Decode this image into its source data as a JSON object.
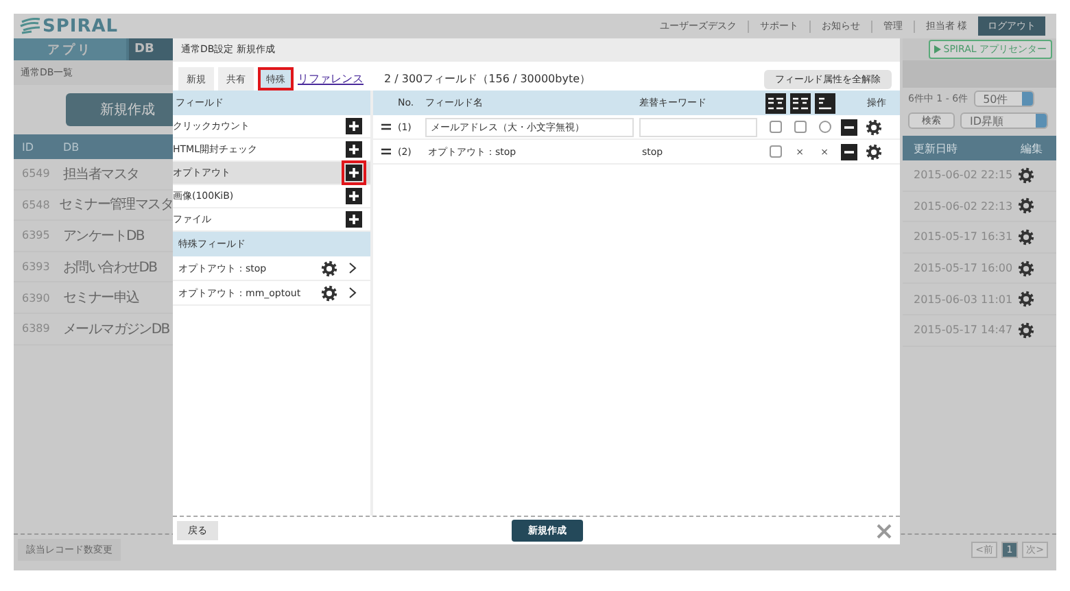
{
  "header": {
    "logo": "SPIRAL",
    "links": [
      "ユーザーズデスク",
      "サポート",
      "お知らせ",
      "管理",
      "担当者 様"
    ],
    "logout": "ログアウト"
  },
  "nav_tabs": [
    {
      "label": "アプリ",
      "selected": false
    },
    {
      "label": "DB",
      "selected": true
    }
  ],
  "app_center": "SPIRAL アプリセンター",
  "db_list": {
    "title": "通常DB一覧",
    "new_button": "新規作成",
    "summary": "6件中 1 - 6件",
    "per_page": "50件",
    "search_button": "検索",
    "sort": "ID昇順",
    "columns": [
      "ID",
      "DB",
      "更新日時",
      "編集"
    ],
    "rows": [
      {
        "id": "6549",
        "db": "担当者マスタ",
        "updated": "2015-06-02 22:15"
      },
      {
        "id": "6548",
        "db": "セミナー管理マスタ",
        "updated": "2015-06-02 22:13"
      },
      {
        "id": "6395",
        "db": "アンケートDB",
        "updated": "2015-05-17 16:31"
      },
      {
        "id": "6393",
        "db": "お問い合わせDB",
        "updated": "2015-05-17 16:00"
      },
      {
        "id": "6390",
        "db": "セミナー申込",
        "updated": "2015-06-03 11:01"
      },
      {
        "id": "6389",
        "db": "メールマガジンDB",
        "updated": "2015-05-17 14:47"
      }
    ]
  },
  "footer": {
    "record_button": "該当レコード数変更",
    "pager": {
      "prev": "<前",
      "page": "1",
      "next": "次>"
    }
  },
  "modal": {
    "title": "通常DB設定 新規作成",
    "tabs": [
      {
        "label": "新規",
        "selected": false,
        "highlighted": false
      },
      {
        "label": "共有",
        "selected": false,
        "highlighted": false
      },
      {
        "label": "特殊",
        "selected": true,
        "highlighted": true
      }
    ],
    "reference_link": "リファレンス",
    "field_count": "2 / 300フィールド（156 / 30000byte）",
    "clear_button": "フィールド属性を全解除",
    "palette_heading": "フィールド",
    "palette_items": [
      {
        "label": "クリックカウント",
        "selected": false,
        "highlighted": false
      },
      {
        "label": "HTML開封チェック",
        "selected": false,
        "highlighted": false
      },
      {
        "label": "オプトアウト",
        "selected": true,
        "highlighted": true
      },
      {
        "label": "画像(100KiB)",
        "selected": false,
        "highlighted": false
      },
      {
        "label": "ファイル",
        "selected": false,
        "highlighted": false
      }
    ],
    "special_heading": "特殊フィールド",
    "special_items": [
      "オプトアウト：stop",
      "オプトアウト：mm_optout"
    ],
    "columns": [
      "No.",
      "フィールド名",
      "差替キーワード",
      "操作"
    ],
    "fields": [
      {
        "no": "(1)",
        "kind": "input",
        "name": "メールアドレス（大・小文字無視）",
        "flags": [
          {
            "kind": "checkbox",
            "checked": false
          },
          {
            "kind": "checkbox",
            "checked": false
          },
          {
            "kind": "radio",
            "checked": false
          }
        ]
      },
      {
        "no": "(2)",
        "kind": "text",
        "name": "オプトアウト：stop",
        "keyword": "stop",
        "flags": [
          {
            "kind": "checkbox",
            "checked": false
          },
          {
            "kind": "text",
            "text": "×"
          },
          {
            "kind": "text",
            "text": "×"
          }
        ]
      }
    ],
    "back_button": "戻る",
    "create_button": "新規作成"
  }
}
